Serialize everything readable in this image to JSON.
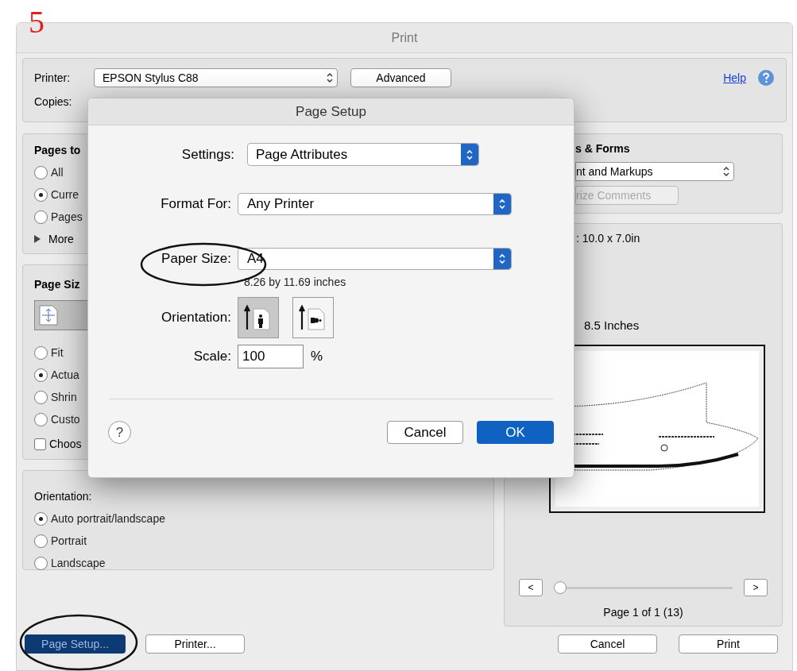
{
  "annotation": "5",
  "window": {
    "title": "Print"
  },
  "printer": {
    "label": "Printer:",
    "value": "EPSON Stylus C88",
    "advanced": "Advanced",
    "help": "Help"
  },
  "copies": {
    "label": "Copies:"
  },
  "pages_panel": {
    "title": "Pages to",
    "options": [
      {
        "label": "All",
        "selected": false
      },
      {
        "label": "Curre",
        "selected": true
      },
      {
        "label": "Pages",
        "selected": false
      }
    ],
    "more": "More"
  },
  "page_size_panel": {
    "title": "Page Siz",
    "options": [
      {
        "label": "Fit",
        "selected": false
      },
      {
        "label": "Actua",
        "selected": true
      },
      {
        "label": "Shrin",
        "selected": false
      },
      {
        "label": "Custo",
        "selected": false
      }
    ],
    "checkbox": {
      "label": "Choos",
      "checked": false
    }
  },
  "orientation_panel": {
    "title": "Orientation:",
    "options": [
      {
        "label": "Auto portrait/landscape",
        "selected": true
      },
      {
        "label": "Portrait",
        "selected": false
      },
      {
        "label": "Landscape",
        "selected": false
      }
    ]
  },
  "comments_panel": {
    "title": "s & Forms",
    "select": "nt and Markups",
    "button": "rize Comments"
  },
  "preview": {
    "size": ": 10.0 x 7.0in",
    "paper": "8.5 Inches",
    "prev": "<",
    "next": ">",
    "level": 0,
    "page_label": "Page 1 of 1 (13)"
  },
  "buttons": {
    "page_setup": "Page Setup...",
    "printer": "Printer...",
    "cancel": "Cancel",
    "print": "Print"
  },
  "page_setup_dialog": {
    "title": "Page Setup",
    "settings": {
      "label": "Settings:",
      "value": "Page Attributes"
    },
    "format_for": {
      "label": "Format For:",
      "value": "Any Printer"
    },
    "paper_size": {
      "label": "Paper Size:",
      "value": "A4",
      "dimensions": "8.26 by 11.69 inches"
    },
    "orientation": {
      "label": "Orientation:",
      "options": [
        {
          "kind": "portrait",
          "selected": true
        },
        {
          "kind": "landscape",
          "selected": false
        }
      ]
    },
    "scale": {
      "label": "Scale:",
      "value": "100",
      "unit": "%"
    },
    "help": "?",
    "cancel": "Cancel",
    "ok": "OK"
  }
}
